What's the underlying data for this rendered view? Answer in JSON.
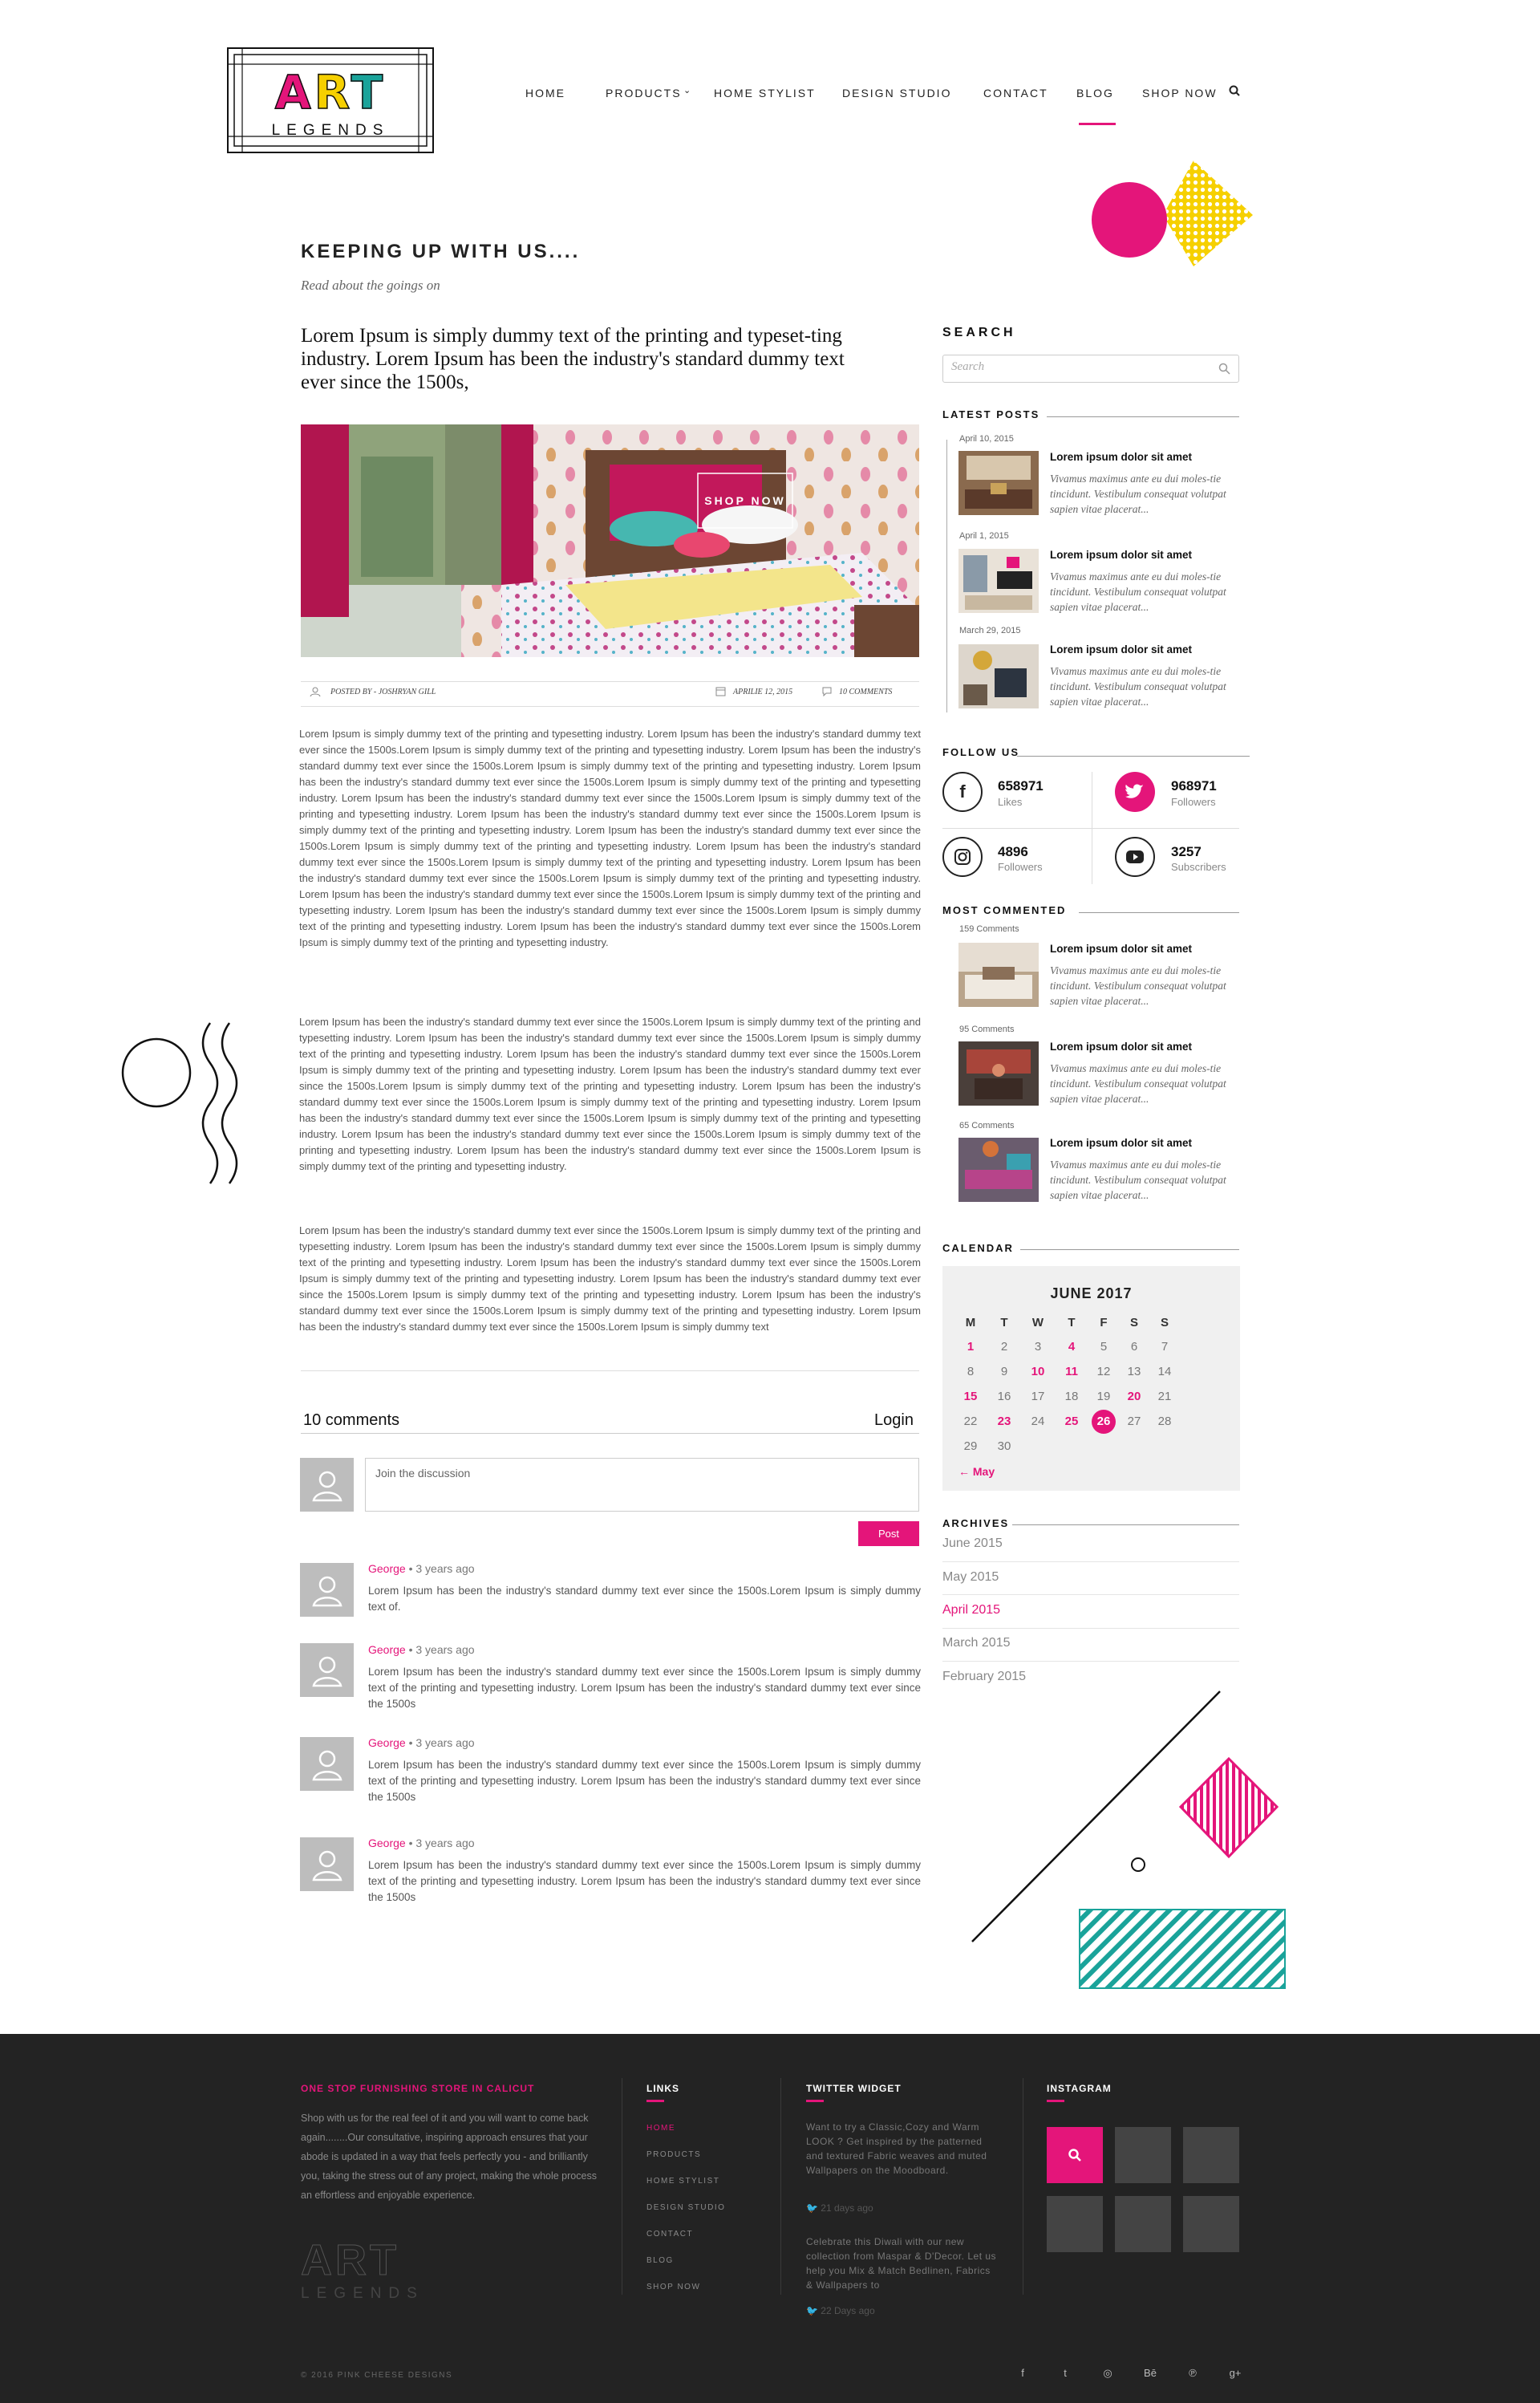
{
  "brand": {
    "logo_top": "ART",
    "logo_bottom": "LEGENDS"
  },
  "nav": {
    "home": "HOME",
    "products": "PRODUCTS",
    "home_stylist": "HOME STYLIST",
    "design_studio": "DESIGN STUDIO",
    "contact": "CONTACT",
    "blog": "BLOG",
    "shop_now": "SHOP NOW",
    "active": "BLOG"
  },
  "colors": {
    "accent": "#e4157a",
    "yellow": "#f6d000",
    "teal": "#1aa39a",
    "footer_bg": "#232323"
  },
  "intro": {
    "title": "KEEPING UP WITH US....",
    "subtitle": "Read about the goings on",
    "lead": "Lorem Ipsum is simply dummy text of the printing and typeset-ting industry. Lorem Ipsum has been the industry's standard dummy text ever since the 1500s,"
  },
  "hero": {
    "button": "SHOP NOW"
  },
  "post_meta": {
    "author": "POSTED BY - JOSHRYAN GILL",
    "date": "APRILIE 12, 2015",
    "comments": "10 COMMENTS"
  },
  "article": {
    "p1": "Lorem Ipsum is simply dummy text of the printing and typesetting industry. Lorem Ipsum has been the industry's standard dummy text ever since the 1500s.Lorem Ipsum is simply dummy text of the printing and typesetting industry. Lorem Ipsum has been the industry's standard dummy text ever since the 1500s.Lorem Ipsum is simply dummy text of the printing and typesetting industry. Lorem Ipsum has been the industry's standard dummy text ever since the 1500s.Lorem Ipsum is simply dummy text of the printing and typesetting industry. Lorem Ipsum has been the industry's standard dummy text ever since the 1500s.Lorem Ipsum is simply dummy text of the printing and typesetting industry. Lorem Ipsum has been the industry's standard dummy text ever since the 1500s.Lorem Ipsum is simply dummy text of the printing and typesetting industry. Lorem Ipsum has been the industry's standard dummy text ever since the 1500s.Lorem Ipsum is simply dummy text of the printing and typesetting industry. Lorem Ipsum has been the industry's standard dummy text ever since the 1500s.Lorem Ipsum is simply dummy text of the printing and typesetting industry. Lorem Ipsum has been the industry's standard dummy text ever since the 1500s.Lorem Ipsum is simply dummy text of the printing and typesetting industry. Lorem Ipsum has been the industry's standard dummy text ever since the 1500s.Lorem Ipsum is simply dummy text of the printing and typesetting industry. Lorem Ipsum has been the industry's standard dummy text ever since the 1500s.Lorem Ipsum is simply dummy text of the printing and typesetting industry. Lorem Ipsum has been the industry's standard dummy text ever since the 1500s.Lorem Ipsum is simply dummy text of the printing and typesetting industry.",
    "p2": "Lorem Ipsum has been the industry's standard dummy text ever since the 1500s.Lorem Ipsum is simply dummy text of the printing and typesetting industry. Lorem Ipsum has been the industry's standard dummy text ever since the 1500s.Lorem Ipsum is simply dummy text of the printing and typesetting industry. Lorem Ipsum has been the industry's standard dummy text ever since the 1500s.Lorem Ipsum is simply dummy text of the printing and typesetting industry. Lorem Ipsum has been the industry's standard dummy text ever since the 1500s.Lorem Ipsum is simply dummy text of the printing and typesetting industry. Lorem Ipsum has been the industry's standard dummy text ever since the 1500s.Lorem Ipsum is simply dummy text of the printing and typesetting industry. Lorem Ipsum has been the industry's standard dummy text ever since the 1500s.Lorem Ipsum is simply dummy text of the printing and typesetting industry. Lorem Ipsum has been the industry's standard dummy text ever since the 1500s.Lorem Ipsum is simply dummy text of the printing and typesetting industry. Lorem Ipsum has been the industry's standard dummy text ever since the 1500s.Lorem Ipsum is simply dummy text of the printing and typesetting industry.",
    "p3": "Lorem Ipsum has been the industry's standard dummy text ever since the 1500s.Lorem Ipsum is simply dummy text of the printing and typesetting industry. Lorem Ipsum has been the industry's standard dummy text ever since the 1500s.Lorem Ipsum is simply dummy text of the printing and typesetting industry. Lorem Ipsum has been the industry's standard dummy text ever since the 1500s.Lorem Ipsum is simply dummy text of the printing and typesetting industry. Lorem Ipsum has been the industry's standard dummy text ever since the 1500s.Lorem Ipsum is simply dummy text of the printing and typesetting industry. Lorem Ipsum has been the industry's standard dummy text ever since the 1500s.Lorem Ipsum is simply dummy text of the printing and typesetting industry. Lorem Ipsum has been the industry's standard dummy text ever since the 1500s.Lorem Ipsum is simply dummy text"
  },
  "comments": {
    "count_label": "10 comments",
    "login": "Login",
    "placeholder": "Join the discussion",
    "post": "Post",
    "items": [
      {
        "author": "George",
        "time": " • 3 years ago",
        "text": "Lorem Ipsum has been the industry's standard dummy text ever since the 1500s.Lorem Ipsum is simply dummy text of."
      },
      {
        "author": "George",
        "time": " • 3 years ago",
        "text": "Lorem Ipsum has been the industry's standard dummy text ever since the 1500s.Lorem Ipsum is simply dummy text of the printing and typesetting industry. Lorem Ipsum has been the industry's standard dummy text ever since the 1500s"
      },
      {
        "author": "George",
        "time": " • 3 years ago",
        "text": "Lorem Ipsum has been the industry's standard dummy text ever since the 1500s.Lorem Ipsum is simply dummy text of the printing and typesetting industry. Lorem Ipsum has been the industry's standard dummy text ever since the 1500s"
      },
      {
        "author": "George",
        "time": " • 3 years ago",
        "text": "Lorem Ipsum has been the industry's standard dummy text ever since the 1500s.Lorem Ipsum is simply dummy text of the printing and typesetting industry. Lorem Ipsum has been the industry's standard dummy text ever since the 1500s"
      }
    ]
  },
  "sidebar": {
    "search_title": "SEARCH",
    "search_placeholder": "Search",
    "latest_title": "LATEST POSTS",
    "latest": [
      {
        "date": "April 10, 2015",
        "title": "Lorem ipsum dolor sit amet",
        "desc": "Vivamus maximus ante eu dui moles-tie tincidunt. Vestibulum consequat volutpat sapien vitae placerat..."
      },
      {
        "date": "April 1, 2015",
        "title": "Lorem ipsum dolor sit amet",
        "desc": "Vivamus maximus ante eu dui moles-tie tincidunt. Vestibulum consequat volutpat sapien vitae placerat..."
      },
      {
        "date": "March 29, 2015",
        "title": "Lorem ipsum dolor sit amet",
        "desc": "Vivamus maximus ante eu dui moles-tie tincidunt. Vestibulum consequat volutpat sapien vitae placerat..."
      }
    ],
    "follow_title": "FOLLOW US",
    "follow": [
      {
        "icon": "facebook-icon",
        "count": "658971",
        "label": "Likes"
      },
      {
        "icon": "twitter-icon",
        "count": "968971",
        "label": "Followers"
      },
      {
        "icon": "instagram-icon",
        "count": "4896",
        "label": "Followers"
      },
      {
        "icon": "youtube-icon",
        "count": "3257",
        "label": "Subscribers"
      }
    ],
    "most_title": "MOST COMMENTED",
    "most": [
      {
        "count": "159 Comments",
        "title": "Lorem ipsum dolor sit amet",
        "desc": "Vivamus maximus ante eu dui moles-tie tincidunt. Vestibulum consequat volutpat sapien vitae placerat..."
      },
      {
        "count": "95 Comments",
        "title": "Lorem ipsum dolor sit amet",
        "desc": "Vivamus maximus ante eu dui moles-tie tincidunt. Vestibulum consequat volutpat sapien vitae placerat..."
      },
      {
        "count": "65 Comments",
        "title": "Lorem ipsum dolor sit amet",
        "desc": "Vivamus maximus ante eu dui moles-tie tincidunt. Vestibulum consequat volutpat sapien vitae placerat..."
      }
    ],
    "calendar_title": "CALENDAR",
    "calendar": {
      "month": "JUNE 2017",
      "dow": [
        "M",
        "T",
        "W",
        "T",
        "F",
        "S",
        "S"
      ],
      "weeks": [
        [
          "1",
          "2",
          "3",
          "4",
          "5",
          "6",
          "7"
        ],
        [
          "8",
          "9",
          "10",
          "11",
          "12",
          "13",
          "14"
        ],
        [
          "15",
          "16",
          "17",
          "18",
          "19",
          "20",
          "21"
        ],
        [
          "22",
          "23",
          "24",
          "25",
          "26",
          "27",
          "28"
        ],
        [
          "29",
          "30",
          "",
          "",
          "",
          "",
          ""
        ]
      ],
      "highlighted": [
        "1",
        "4",
        "10",
        "11",
        "15",
        "20",
        "23",
        "25"
      ],
      "today": "26",
      "prev": "← May"
    },
    "archives_title": "ARCHIVES",
    "archives": [
      "June 2015",
      "May 2015",
      "April 2015",
      "March 2015",
      "February 2015"
    ],
    "archives_active": "April 2015"
  },
  "footer": {
    "about_title": "ONE STOP FURNISHING STORE IN CALICUT",
    "about_text": "Shop with us for the real feel of it and you will want to come back again........Our consultative, inspiring approach ensures that your abode is updated in a way that feels perfectly you - and brilliantly you, taking the stress out of any project, making the whole process an effortless and enjoyable experience.",
    "links_title": "LINKS",
    "links": [
      "HOME",
      "PRODUCTS",
      "HOME STYLIST",
      "DESIGN STUDIO",
      "CONTACT",
      "BLOG",
      "SHOP NOW"
    ],
    "twitter_title": "TWITTER WIDGET",
    "tweets": [
      {
        "text": "Want to try a Classic,Cozy and Warm LOOK ? Get inspired by the patterned and textured Fabric weaves and muted Wallpapers on the Moodboard.",
        "time": "21 days ago"
      },
      {
        "text": "Celebrate this Diwali with our new collection from Maspar & D'Decor. Let us help you Mix & Match Bedlinen, Fabrics & Wallpapers to",
        "time": "22 Days ago"
      }
    ],
    "instagram_title": "INSTAGRAM",
    "copyright": "© 2016 PINK CHEESE DESIGNS",
    "social": [
      "f",
      "t",
      "◎",
      "Bē",
      "℗",
      "g+"
    ]
  }
}
